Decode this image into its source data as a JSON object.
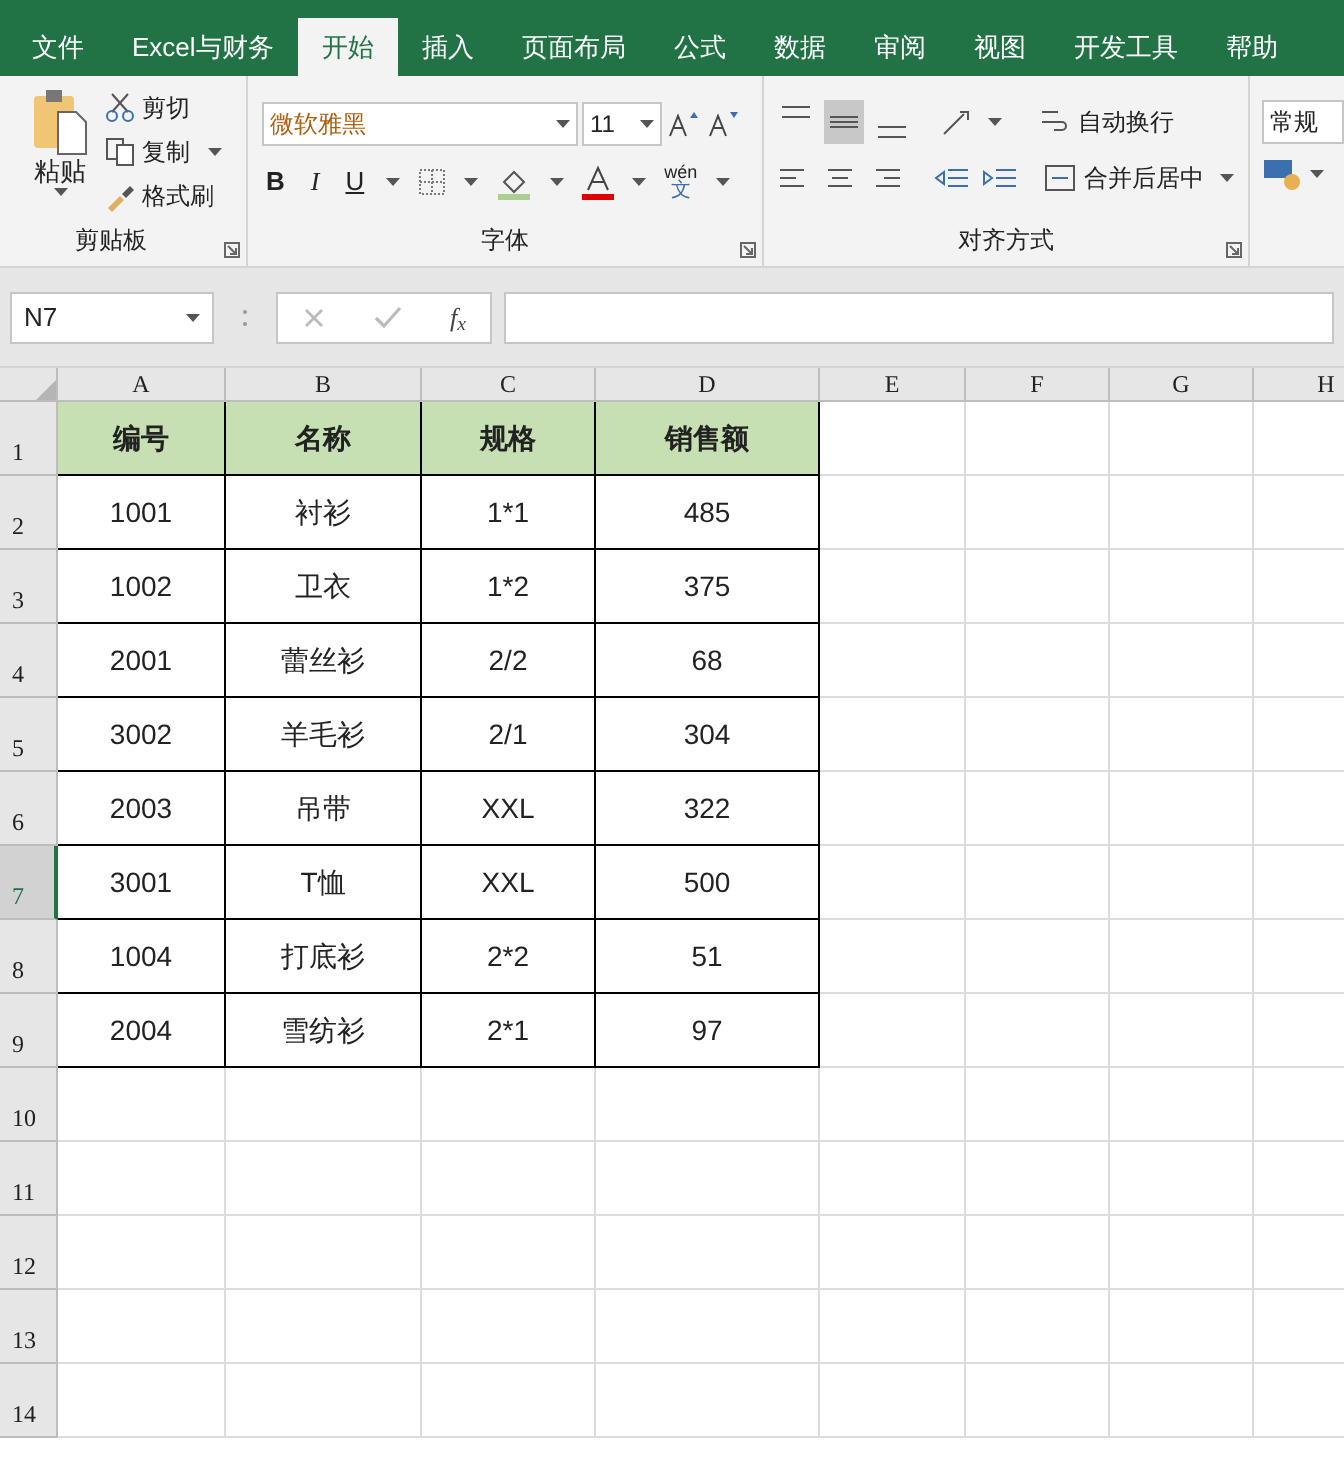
{
  "tabs": [
    {
      "label": "文件",
      "selected": false
    },
    {
      "label": "Excel与财务",
      "selected": false
    },
    {
      "label": "开始",
      "selected": true
    },
    {
      "label": "插入",
      "selected": false
    },
    {
      "label": "页面布局",
      "selected": false
    },
    {
      "label": "公式",
      "selected": false
    },
    {
      "label": "数据",
      "selected": false
    },
    {
      "label": "审阅",
      "selected": false
    },
    {
      "label": "视图",
      "selected": false
    },
    {
      "label": "开发工具",
      "selected": false
    },
    {
      "label": "帮助",
      "selected": false
    }
  ],
  "ribbon": {
    "clipboard": {
      "paste": "粘贴",
      "cut": "剪切",
      "copy": "复制",
      "format_painter": "格式刷",
      "group_label": "剪贴板"
    },
    "font": {
      "font_name": "微软雅黑",
      "font_size": "11",
      "bold": "B",
      "italic": "I",
      "underline": "U",
      "phonetic_top": "wén",
      "phonetic_bottom": "文",
      "group_label": "字体"
    },
    "alignment": {
      "vertical": [
        {
          "selected": false
        },
        {
          "selected": true
        },
        {
          "selected": false
        }
      ],
      "wrap_text": "自动换行",
      "merge_center": "合并后居中",
      "group_label": "对齐方式"
    },
    "number": {
      "format": "常规"
    }
  },
  "formula_bar": {
    "name_box": "N7",
    "function_label": "f$_{x}$"
  },
  "sheet": {
    "columns": [
      {
        "label": "A",
        "selected": false
      },
      {
        "label": "B",
        "selected": false
      },
      {
        "label": "C",
        "selected": false
      },
      {
        "label": "D",
        "selected": false
      },
      {
        "label": "E",
        "selected": false
      },
      {
        "label": "F",
        "selected": false
      },
      {
        "label": "G",
        "selected": false
      },
      {
        "label": "H",
        "selected": false
      }
    ],
    "row_headers": [
      {
        "label": "1",
        "selected": false
      },
      {
        "label": "2",
        "selected": false
      },
      {
        "label": "3",
        "selected": false
      },
      {
        "label": "4",
        "selected": false
      },
      {
        "label": "5",
        "selected": false
      },
      {
        "label": "6",
        "selected": false
      },
      {
        "label": "7",
        "selected": true
      },
      {
        "label": "8",
        "selected": false
      },
      {
        "label": "9",
        "selected": false
      },
      {
        "label": "10",
        "selected": false
      },
      {
        "label": "11",
        "selected": false
      },
      {
        "label": "12",
        "selected": false
      },
      {
        "label": "13",
        "selected": false
      },
      {
        "label": "14",
        "selected": false
      }
    ],
    "table": {
      "header": [
        "编号",
        "名称",
        "规格",
        "销售额"
      ],
      "rows": [
        [
          "1001",
          "衬衫",
          "1*1",
          "485"
        ],
        [
          "1002",
          "卫衣",
          "1*2",
          "375"
        ],
        [
          "2001",
          "蕾丝衫",
          "2/2",
          "68"
        ],
        [
          "3002",
          "羊毛衫",
          "2/1",
          "304"
        ],
        [
          "2003",
          "吊带",
          "XXL",
          "322"
        ],
        [
          "3001",
          "T恤",
          "XXL",
          "500"
        ],
        [
          "1004",
          "打底衫",
          "2*2",
          "51"
        ],
        [
          "2004",
          "雪纺衫",
          "2*1",
          "97"
        ]
      ]
    }
  }
}
